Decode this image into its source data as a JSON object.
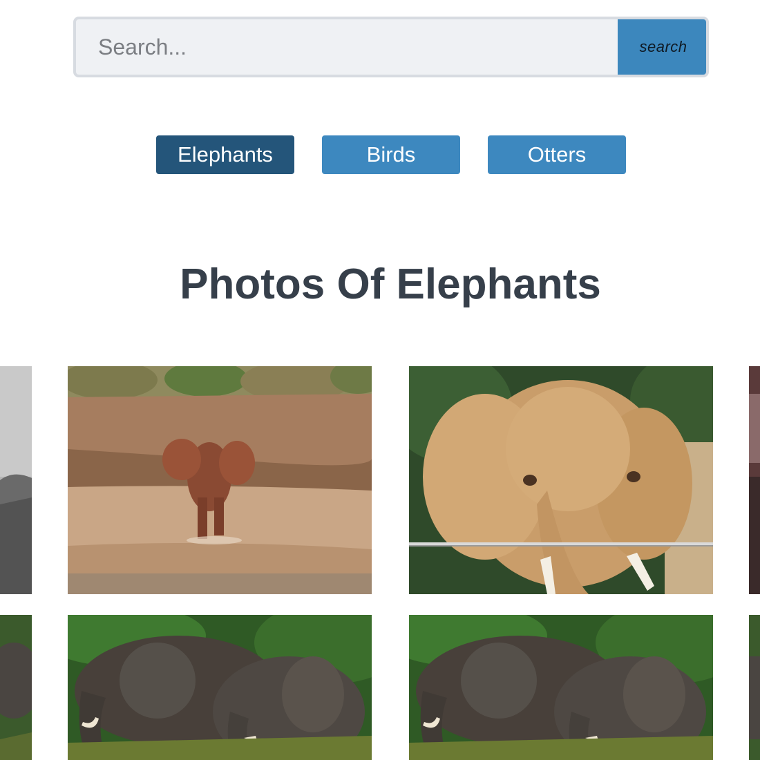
{
  "search": {
    "placeholder": "Search...",
    "button_label": "search"
  },
  "tabs": [
    {
      "label": "Elephants",
      "active": true
    },
    {
      "label": "Birds",
      "active": false
    },
    {
      "label": "Otters",
      "active": false
    }
  ],
  "heading": "Photos Of Elephants",
  "colors": {
    "button_blue": "#3c87bd",
    "active_tab": "#24557a",
    "heading_text": "#363f4a",
    "search_bg": "#eff1f4"
  }
}
